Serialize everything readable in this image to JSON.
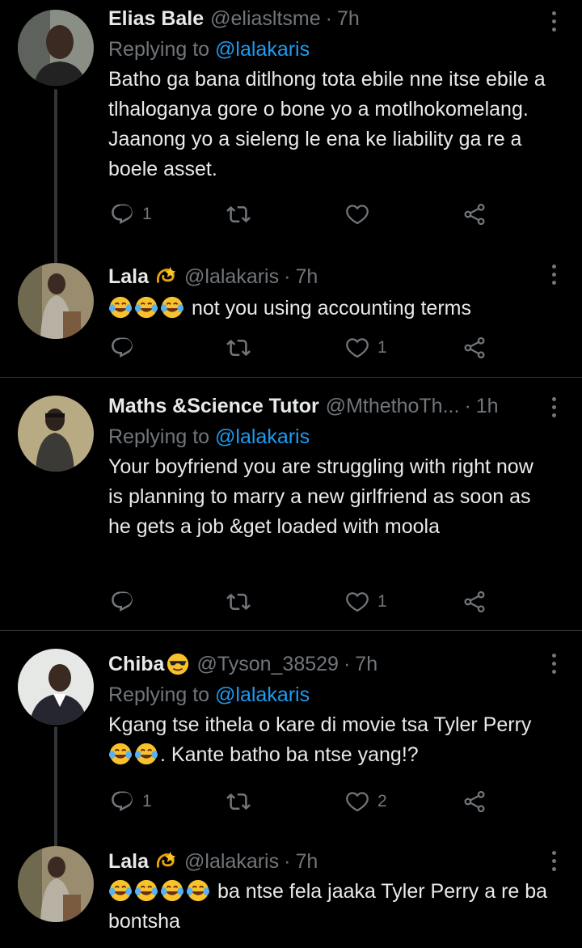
{
  "tweets": [
    {
      "name": "Elias  Bale",
      "handle": "@eliasltsme",
      "time": "7h",
      "replying_label": "Replying to",
      "replying_to": "@lalakaris",
      "text": "Batho ga  bana ditlhong tota ebile nne itse ebile a tlhaloganya gore o bone yo a motlhokomelang. Jaanong yo a sieleng le ena ke liability ga re a boele asset.",
      "replies": "1",
      "retweets": "",
      "likes": ""
    },
    {
      "name": "Lala",
      "name_emoji": "dizzy-emoji",
      "handle": "@lalakaris",
      "time": "7h",
      "text_emojis": [
        "tears-of-joy-emoji",
        "tears-of-joy-emoji",
        "tears-of-joy-emoji"
      ],
      "text": "not you using accounting terms",
      "replies": "",
      "retweets": "",
      "likes": "1"
    },
    {
      "name": "Maths &Science Tutor",
      "handle": "@MthethoTh...",
      "time": "1h",
      "replying_label": "Replying to",
      "replying_to": "@lalakaris",
      "text": "Your boyfriend you are struggling with right now is planning to marry a new girlfriend as soon as he gets a job &get  loaded with moola",
      "replies": "",
      "retweets": "",
      "likes": "1"
    },
    {
      "name": "Chiba",
      "name_emoji": "sunglasses-emoji",
      "handle": "@Tyson_38529",
      "time": "7h",
      "replying_label": "Replying to",
      "replying_to": "@lalakaris",
      "text_part1": "Kgang tse ithela o kare di movie tsa Tyler Perry",
      "text_part2": ". Kante batho ba ntse yang!?",
      "replies": "1",
      "retweets": "",
      "likes": "2"
    },
    {
      "name": "Lala",
      "name_emoji": "dizzy-emoji",
      "handle": "@lalakaris",
      "time": "7h",
      "text": "ba ntse fela jaaka Tyler Perry a re ba bontsha"
    }
  ],
  "colors": {
    "background": "#000000",
    "text": "#e7e9ea",
    "muted": "#71767b",
    "link": "#1d9bf0",
    "divider": "#2f3336"
  }
}
